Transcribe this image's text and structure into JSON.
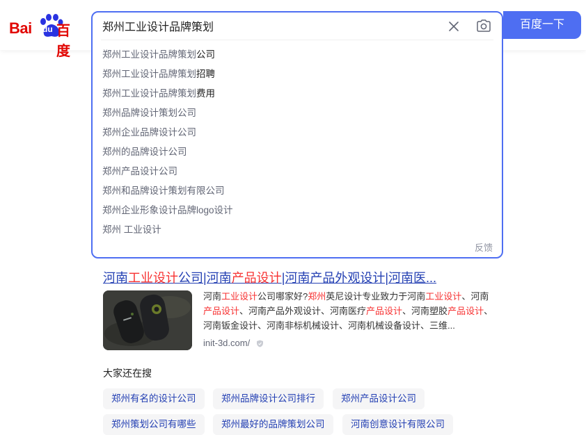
{
  "logo": {
    "text_bai": "Bai",
    "text_du": "du",
    "text_cn": "百度",
    "brand_color": "#e10602",
    "paw_color": "#2932e1"
  },
  "search": {
    "query": "郑州工业设计品牌策划",
    "button_label": "百度一下",
    "accent_color": "#4e6ef2",
    "clear_icon": "close-icon",
    "camera_icon": "camera-icon"
  },
  "suggestions": [
    {
      "prefix": "郑州工业设计品牌策划",
      "rest": "公司"
    },
    {
      "prefix": "郑州工业设计品牌策划",
      "rest": "招聘"
    },
    {
      "prefix": "郑州工业设计品牌策划",
      "rest": "费用"
    },
    {
      "prefix": "郑州品牌设计策划公司",
      "rest": ""
    },
    {
      "prefix": "郑州企业品牌设计公司",
      "rest": ""
    },
    {
      "prefix": "郑州的品牌设计公司",
      "rest": ""
    },
    {
      "prefix": "郑州产品设计公司",
      "rest": ""
    },
    {
      "prefix": "郑州和品牌设计策划有限公司",
      "rest": ""
    },
    {
      "prefix": "郑州企业形象设计品牌logo设计",
      "rest": ""
    },
    {
      "prefix": "郑州 工业设计",
      "rest": ""
    }
  ],
  "feedback_label": "反馈",
  "result": {
    "title_parts": [
      "河南",
      "工业设计",
      "公司|河南",
      "产品设计",
      "|河南产品外观设计|河南医..."
    ],
    "abstract_parts": [
      "河南",
      "工业设计",
      "公司哪家好?",
      "郑州",
      "英尼设计专业致力于河南",
      "工业设计",
      "、河南",
      "产品设计",
      "、河南产品外观设计、河南医疗",
      "产品设计",
      "、河南塑胶",
      "产品设计",
      "、河南钣金设计、河南非标机械设计、河南机械设备设计、三维..."
    ],
    "url": "init-3d.com/"
  },
  "related": {
    "title": "大家还在搜",
    "items": [
      "郑州有名的设计公司",
      "郑州品牌设计公司排行",
      "郑州产品设计公司",
      "郑州策划公司有哪些",
      "郑州最好的品牌策划公司",
      "河南创意设计有限公司"
    ]
  }
}
